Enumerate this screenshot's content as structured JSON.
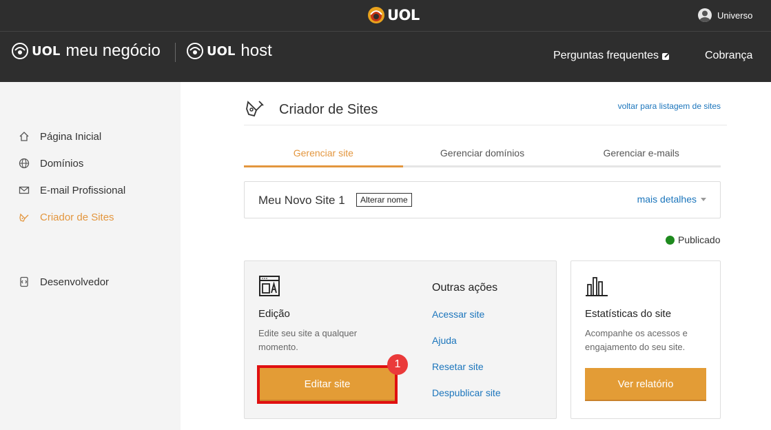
{
  "top_bar": {
    "logo_text": "UOL",
    "user_name": "Universo"
  },
  "brand_bar": {
    "brand1_uol": "UOL",
    "brand1_product": "meu negócio",
    "brand2_uol": "UOL",
    "brand2_product": "host",
    "nav": [
      {
        "label": "Perguntas frequentes",
        "icon": "external-link-icon"
      },
      {
        "label": "Cobrança"
      }
    ]
  },
  "sidebar": {
    "items": [
      {
        "label": "Página Inicial",
        "icon": "home-icon",
        "active": false
      },
      {
        "label": "Domínios",
        "icon": "globe-icon",
        "active": false
      },
      {
        "label": "E-mail Profissional",
        "icon": "mail-icon",
        "active": false
      },
      {
        "label": "Criador de Sites",
        "icon": "pen-tool-icon",
        "active": true
      },
      {
        "label": "Desenvolvedor",
        "icon": "developer-icon",
        "active": false
      }
    ]
  },
  "page": {
    "title": "Criador de Sites",
    "back_link": "voltar para listagem de sites",
    "tabs": [
      {
        "label": "Gerenciar site",
        "active": true
      },
      {
        "label": "Gerenciar domínios",
        "active": false
      },
      {
        "label": "Gerenciar e-mails",
        "active": false
      }
    ],
    "site": {
      "name": "Meu Novo Site 1",
      "rename_label": "Alterar nome",
      "more_details": "mais detalhes"
    },
    "status": {
      "label": "Publicado",
      "color": "#1e8a1e"
    },
    "edit_card": {
      "title": "Edição",
      "desc_line1": "Edite seu site a qualquer",
      "desc_line2": "momento.",
      "button": "Editar site",
      "step_number": "1",
      "other_title": "Outras ações",
      "links": [
        "Acessar site",
        "Ajuda",
        "Resetar site",
        "Despublicar site"
      ]
    },
    "stats_card": {
      "title": "Estatísticas do site",
      "desc_line1": "Acompanhe os acessos e",
      "desc_line2": "engajamento do seu site.",
      "button": "Ver relatório"
    }
  },
  "colors": {
    "accent": "#e3963e",
    "link": "#1b75bc",
    "header_bg": "#2e2e2e",
    "highlight": "#e01010"
  }
}
